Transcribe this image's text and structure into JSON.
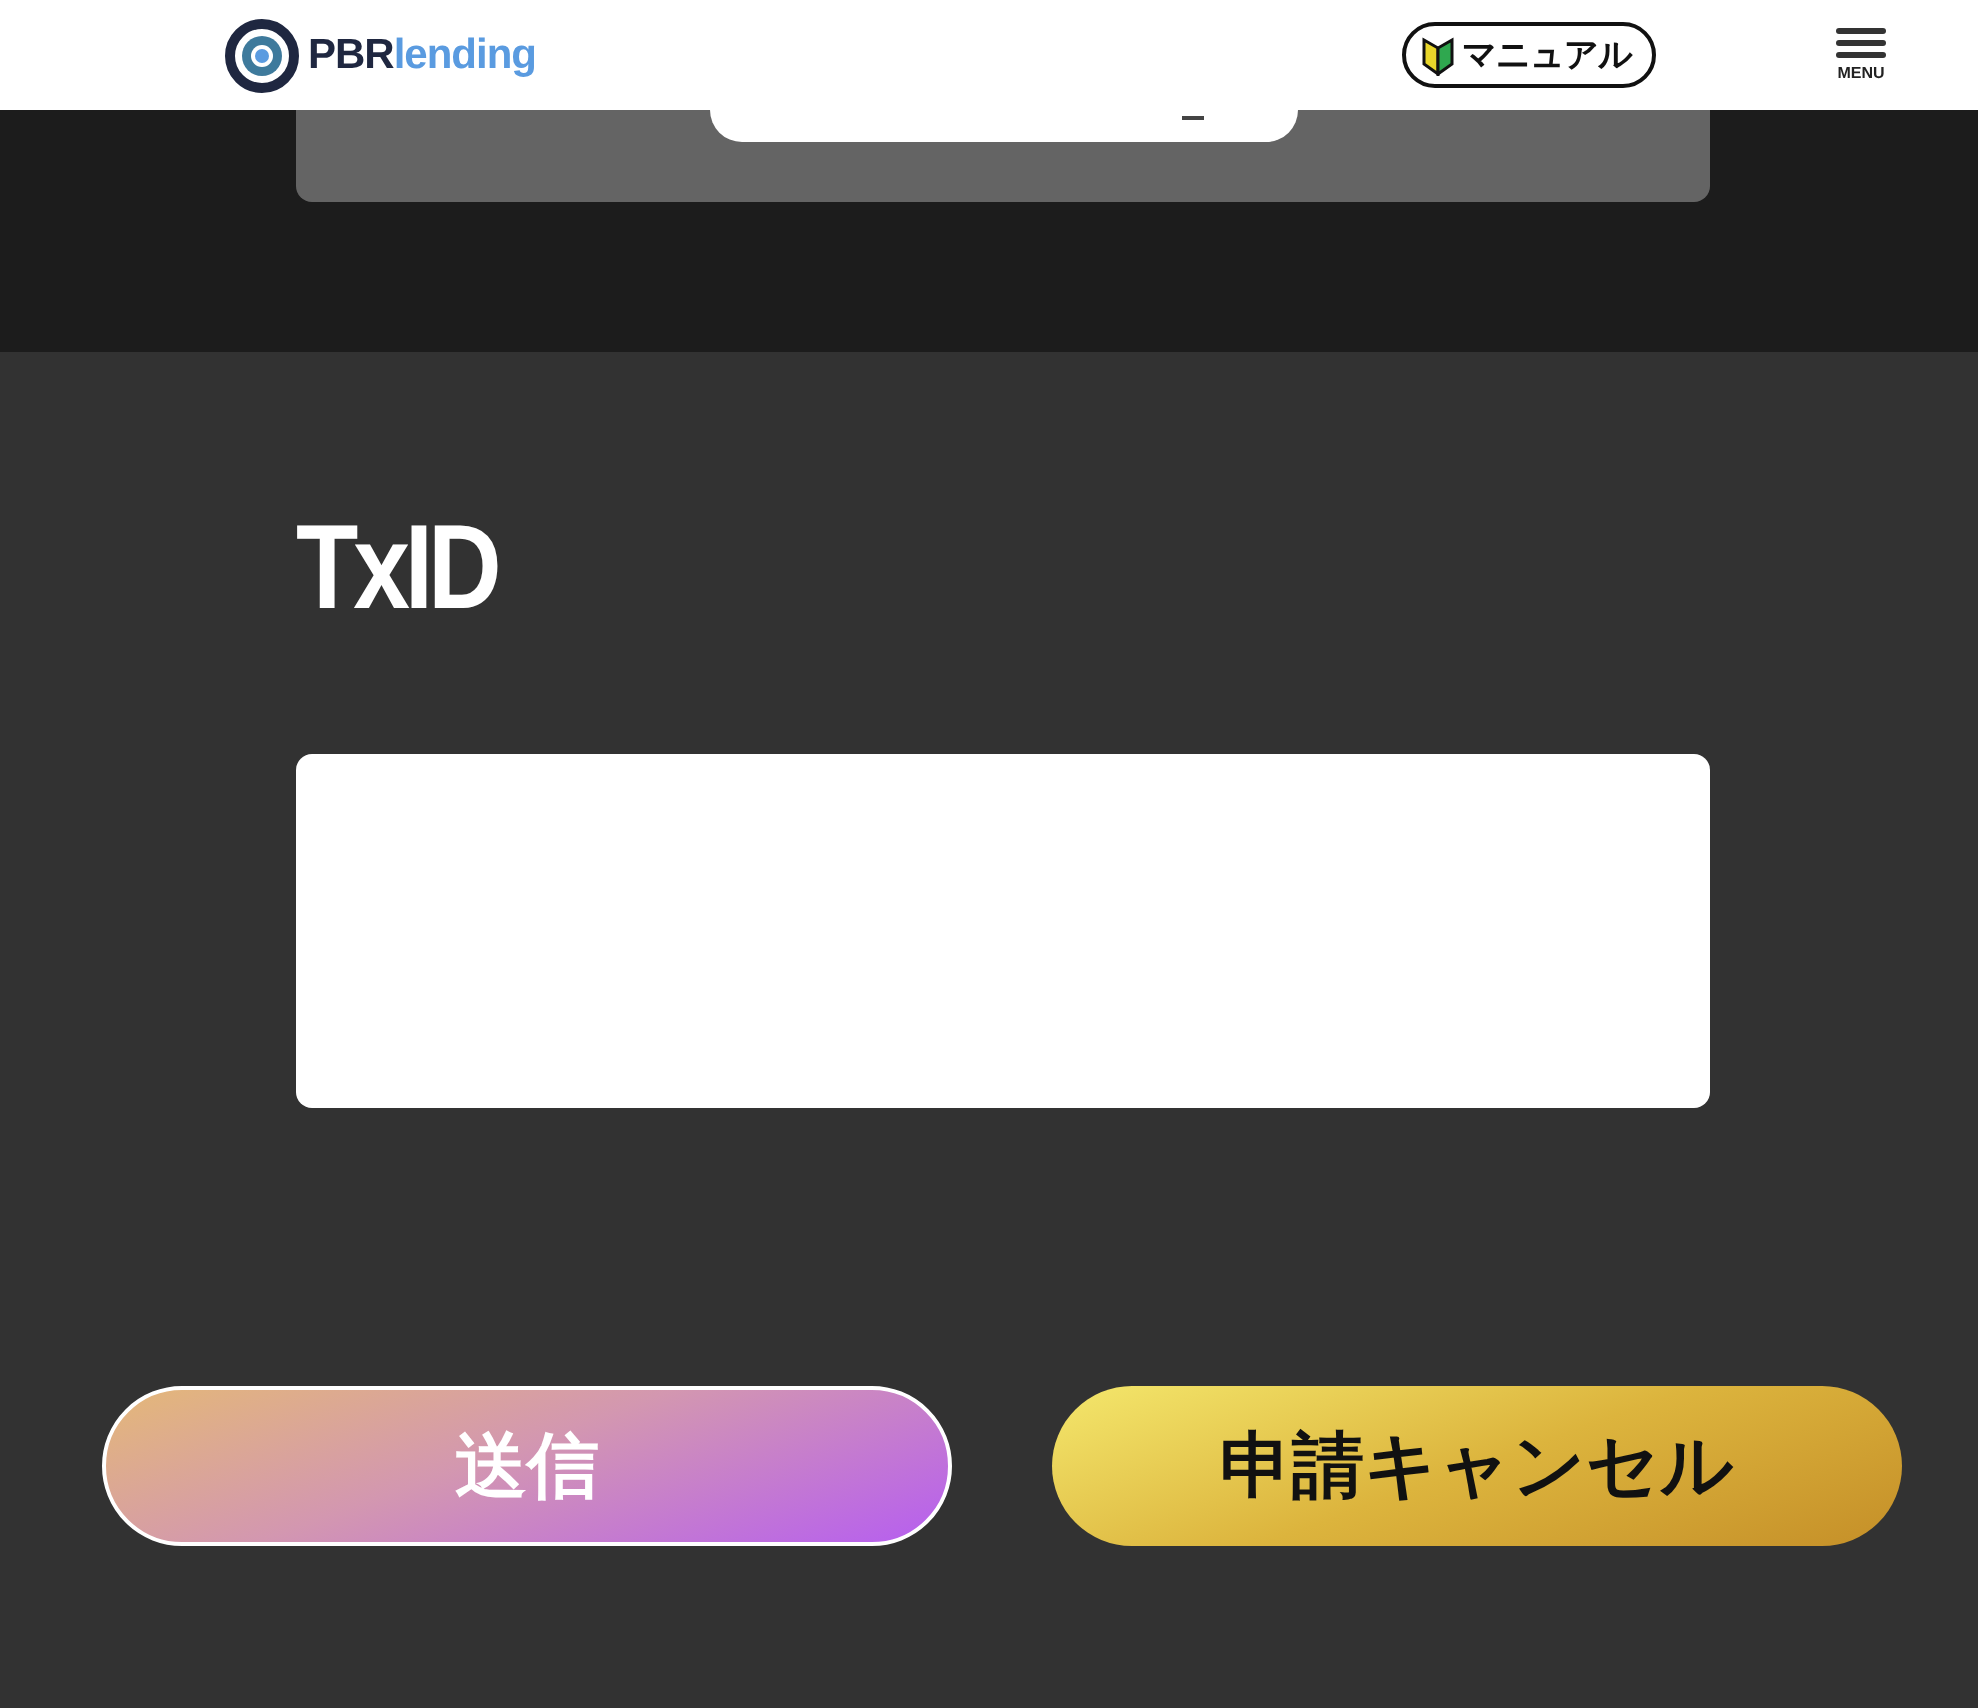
{
  "header": {
    "logo": {
      "bold": "PBR",
      "light": "lending"
    },
    "manual_button": "マニュアル",
    "menu_label": "MENU"
  },
  "txid_section": {
    "heading": "TxID"
  },
  "buttons": [
    {
      "label": "送信",
      "kind": "primary"
    },
    {
      "label": "申請キャンセル",
      "kind": "secondary"
    }
  ]
}
